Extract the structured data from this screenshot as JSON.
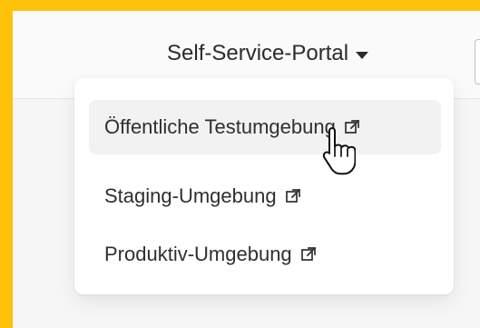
{
  "header": {
    "portal_label": "Self-Service-Portal",
    "caret_icon": "caret-down-icon"
  },
  "dropdown": {
    "items": [
      {
        "label": "Öffentliche Testumgebung",
        "icon": "external-link-icon",
        "active": true
      },
      {
        "label": "Staging-Umgebung",
        "icon": "external-link-icon",
        "active": false
      },
      {
        "label": "Produktiv-Umgebung",
        "icon": "external-link-icon",
        "active": false
      }
    ]
  },
  "pointer": {
    "icon": "hand-pointer-icon"
  },
  "colors": {
    "frame": "#ffc20a",
    "page": "#f6f6f6",
    "menu_bg": "#ffffff",
    "hover_bg": "#f2f2f2",
    "text": "#2f2f2f"
  }
}
